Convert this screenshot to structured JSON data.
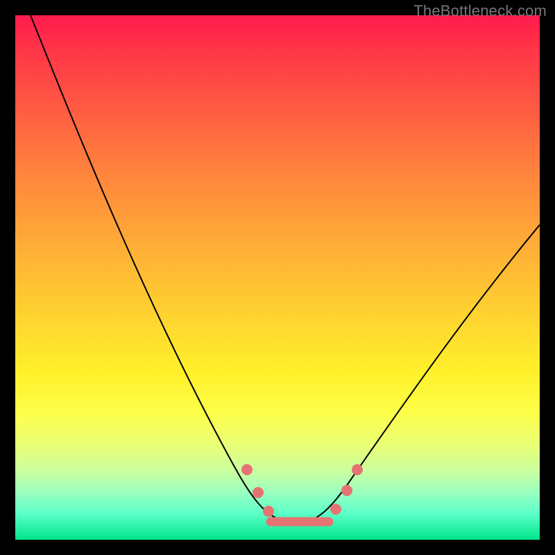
{
  "watermark": "TheBottleneck.com",
  "colors": {
    "frame_bg_top": "#ff1a4d",
    "frame_bg_bottom": "#00e58a",
    "curve": "#000000",
    "marker": "#e57373",
    "page_bg": "#000000",
    "watermark": "#777777"
  },
  "chart_data": {
    "type": "line",
    "title": "",
    "xlabel": "",
    "ylabel": "",
    "xlim": [
      0,
      100
    ],
    "ylim": [
      0,
      100
    ],
    "x": [
      3,
      10,
      20,
      30,
      40,
      45,
      48,
      50,
      52,
      55,
      57,
      60,
      63,
      67,
      72,
      78,
      85,
      92,
      100
    ],
    "values": [
      100,
      83,
      62,
      42,
      23,
      14,
      8,
      5,
      3.5,
      3,
      3,
      3.3,
      5,
      9,
      16,
      25,
      36,
      47,
      60
    ],
    "annotations": {
      "flat_region_x": [
        49,
        60
      ],
      "flat_region_y": 3,
      "marker_dots": [
        {
          "x": 44.5,
          "y": 13
        },
        {
          "x": 47,
          "y": 8.5
        },
        {
          "x": 49,
          "y": 5
        },
        {
          "x": 61,
          "y": 5.5
        },
        {
          "x": 63.5,
          "y": 9
        },
        {
          "x": 65.5,
          "y": 13
        }
      ]
    }
  }
}
